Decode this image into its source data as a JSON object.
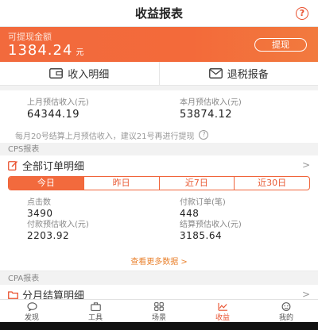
{
  "header": {
    "title": "收益报表",
    "help_icon": "?"
  },
  "balance": {
    "label": "可提现金额",
    "amount": "1384.24",
    "unit": "元",
    "withdraw_label": "提现"
  },
  "actions": [
    {
      "label": "收入明细",
      "icon": "wallet-icon"
    },
    {
      "label": "退税报备",
      "icon": "mail-icon"
    }
  ],
  "estimates": {
    "last_month_label": "上月预估收入(元)",
    "last_month_value": "64344.19",
    "this_month_label": "本月预估收入(元)",
    "this_month_value": "53874.12"
  },
  "notice": {
    "text": "每月20号结算上月预估收入，建议21号再进行提现"
  },
  "cps": {
    "section_label": "CPS报表",
    "orders_label": "全部订单明细",
    "tabs": [
      "今日",
      "昨日",
      "近7日",
      "近30日"
    ],
    "active_tab": "今日",
    "stats": {
      "clicks_label": "点击数",
      "clicks_value": "3490",
      "paid_orders_label": "付款订单(笔)",
      "paid_orders_value": "448",
      "paid_income_label": "付款预估收入(元)",
      "paid_income_value": "2203.92",
      "settle_income_label": "结算预估收入(元)",
      "settle_income_value": "3185.64"
    },
    "more_label": "查看更多数据 >"
  },
  "cpa": {
    "section_label": "CPA报表",
    "monthly_label": "分月结算明细"
  },
  "tabbar": {
    "items": [
      {
        "label": "发现",
        "icon": "chat-icon"
      },
      {
        "label": "工具",
        "icon": "toolbox-icon"
      },
      {
        "label": "场景",
        "icon": "grid-icon"
      },
      {
        "label": "收益",
        "icon": "chart-icon"
      },
      {
        "label": "我的",
        "icon": "user-icon"
      }
    ],
    "active": "收益"
  },
  "colors": {
    "accent": "#f26a3d",
    "accent_dark": "#e9512f",
    "more_link": "#e9822f"
  }
}
